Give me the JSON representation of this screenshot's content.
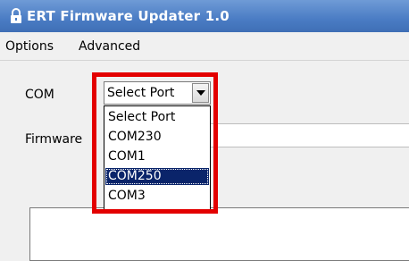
{
  "window": {
    "title": "ERT Firmware Updater 1.0",
    "title_bar_color": "#4a7cc4"
  },
  "menu": {
    "items": [
      {
        "label": "Options"
      },
      {
        "label": "Advanced"
      }
    ]
  },
  "form": {
    "com_label": "COM",
    "port_combo_value": "Select Port",
    "firmware_label": "Firmware",
    "firmware_value": ""
  },
  "dropdown": {
    "options": [
      {
        "label": "Select Port",
        "selected": false
      },
      {
        "label": "COM230",
        "selected": false
      },
      {
        "label": "COM1",
        "selected": false
      },
      {
        "label": "COM250",
        "selected": true
      },
      {
        "label": "COM3",
        "selected": false
      }
    ],
    "selection_color": "#0a246a"
  },
  "annotation": {
    "highlight_color": "#e30000"
  },
  "icons": {
    "title": "lock-icon",
    "combo_button": "chevron-down-icon"
  }
}
